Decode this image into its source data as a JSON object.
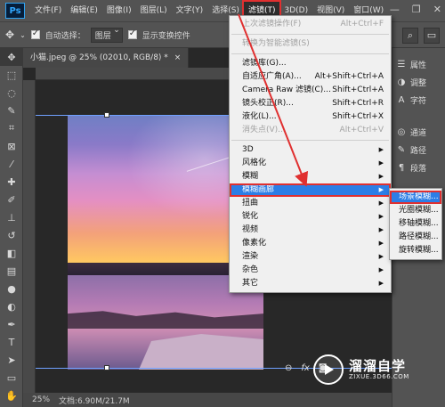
{
  "app": {
    "logo": "Ps"
  },
  "menubar": {
    "items": [
      "文件(F)",
      "编辑(E)",
      "图像(I)",
      "图层(L)",
      "文字(Y)",
      "选择(S)",
      "滤镜(T)",
      "3D(D)",
      "视图(V)",
      "窗口(W)"
    ],
    "active_index": 6
  },
  "optbar": {
    "auto_select_label": "自动选择：",
    "auto_select_value": "图层",
    "show_transform_label": "显示变换控件"
  },
  "document": {
    "tab_title": "小猫.jpeg @ 25% (02010, RGB/8) *"
  },
  "status": {
    "zoom": "25%",
    "doc_info": "文档:6.90M/21.7M"
  },
  "right_panel": {
    "group1": [
      "属性",
      "调整",
      "字符"
    ],
    "group2": [
      "通道",
      "路径",
      "段落"
    ]
  },
  "filter_menu": {
    "items": [
      {
        "label": "上次滤镜操作(F)",
        "shortcut": "Alt+Ctrl+F",
        "disabled": true
      },
      {
        "sep": true
      },
      {
        "label": "转换为智能滤镜(S)",
        "disabled": true
      },
      {
        "sep": true
      },
      {
        "label": "滤镜库(G)..."
      },
      {
        "label": "自适应广角(A)...",
        "shortcut": "Alt+Shift+Ctrl+A"
      },
      {
        "label": "Camera Raw 滤镜(C)...",
        "shortcut": "Shift+Ctrl+A"
      },
      {
        "label": "镜头校正(R)...",
        "shortcut": "Shift+Ctrl+R"
      },
      {
        "label": "液化(L)...",
        "shortcut": "Shift+Ctrl+X"
      },
      {
        "label": "消失点(V)...",
        "shortcut": "Alt+Ctrl+V",
        "disabled": true
      },
      {
        "sep": true
      },
      {
        "label": "3D",
        "submenu": true
      },
      {
        "label": "风格化",
        "submenu": true
      },
      {
        "label": "模糊",
        "submenu": true
      },
      {
        "label": "模糊画廊",
        "submenu": true,
        "highlighted": true
      },
      {
        "label": "扭曲",
        "submenu": true
      },
      {
        "label": "锐化",
        "submenu": true
      },
      {
        "label": "视频",
        "submenu": true
      },
      {
        "label": "像素化",
        "submenu": true
      },
      {
        "label": "渲染",
        "submenu": true
      },
      {
        "label": "杂色",
        "submenu": true
      },
      {
        "label": "其它",
        "submenu": true
      }
    ]
  },
  "blur_gallery_submenu": {
    "items": [
      {
        "label": "场景模糊...",
        "highlighted": true
      },
      {
        "label": "光圈模糊..."
      },
      {
        "label": "移轴模糊..."
      },
      {
        "label": "路径模糊..."
      },
      {
        "label": "旋转模糊..."
      }
    ]
  },
  "watermark": {
    "title": "溜溜自学",
    "subtitle": "ZIXUE.3D66.COM"
  },
  "colors": {
    "highlight": "#2c7ee6",
    "annotation_red": "#e03030"
  }
}
